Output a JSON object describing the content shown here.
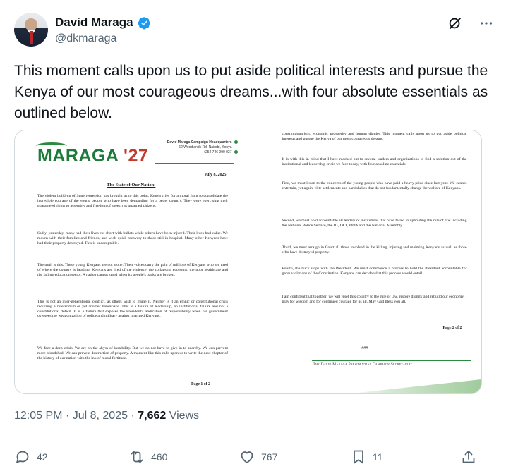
{
  "author": {
    "name": "David Maraga",
    "handle": "@dkmaraga"
  },
  "tweet": {
    "text": "This moment calls upon us to put aside political interests and pursue the Kenya of our most courageous dreams...with four absolute essentials as outlined below."
  },
  "document": {
    "logo_text": "MARAGA",
    "logo_year": "'27",
    "hq_title": "David Maraga Campaign Headquarters",
    "hq_address": "62 Woodlands Rd, Nairobi, Kenya",
    "hq_phone": "+254 746 990 027",
    "date": "July 8, 2025",
    "heading": "The State of Our Nation:",
    "page1_paragraphs": [
      "The violent build-up of State repression has brought us to this point. Kenya cries for a moral front to consolidate the incredible courage of the young people who have been demanding for a better country. They were exercising their guaranteed rights to assembly and freedom of speech as unarmed citizens.",
      "Sadly, yesterday, many had their lives cut short with bullets while others have been injured. Their lives had value. We mourn with their families and friends, and wish quick recovery to those still in hospital. Many other Kenyans have had their property destroyed. This is unacceptable.",
      "The truth is this. These young Kenyans are not alone. Their voices carry the pain of millions of Kenyans who are tired of where the country is heading. Kenyans are tired of the violence, the collapsing economy, the poor healthcare and the failing education sector. A nation cannot stand when its people's backs are broken.",
      "This is not an inter-generational conflict, as others wish to frame it. Neither is it an ethnic or constitutional crisis requiring a referendum or yet another handshake. This is a failure of leadership, an institutional failure and not a constitutional deficit. It is a failure that exposes the President's abdication of responsibility when his government oversees the weaponization of police and military against unarmed Kenyans.",
      "We face a deep crisis. We are on the abyss of instability. But we do not have to give in to anarchy. We can prevent more bloodshed. We can prevent destruction of property. A moment like this calls upon us to write the next chapter of the history of our nation with the ink of moral fortitude."
    ],
    "page1_number": "Page 1 of 2",
    "page2_paragraphs": [
      "constitutionalism, economic prosperity and human dignity. This moment calls upon us to put aside political interests and pursue the Kenya of our most courageous dreams.",
      "It is with this in mind that I have reached out to several leaders and organizations to find a solution out of the institutional and leadership crisis we face today, with four absolute essentials:",
      "First, we must listen to the concerns of the young people who have paid a heavy price since last year. We cannot entertain, yet again, elite settlements and handshakes that do not fundamentally change the welfare of Kenyans.",
      "Second, we must hold accountable all leaders of institutions that have failed in upholding the rule of law including the National Police Service, the IG, DCI, IPOA and the National Assembly.",
      "Third, we must arraign in Court all those involved in the killing, injuring and maiming Kenyans as well as those who have destroyed property.",
      "Fourth, the buck stops with the President. We must commence a process to hold the President accountable for gross violations of the Constitution. Kenyans can decide what this process would entail.",
      "I am confident that together, we will reset this country to the rule of law, restore dignity and rebuild our economy. I pray for wisdom and for continued courage for us all. May God bless you all."
    ],
    "page2_number": "Page 2 of 2",
    "end_mark": "###",
    "signature": "The David Maraga Presidential Campaign Secretariat"
  },
  "meta": {
    "time": "12:05 PM",
    "date": "Jul 8, 2025",
    "views_count": "7,662",
    "views_label": "Views"
  },
  "actions": {
    "replies": "42",
    "reposts": "460",
    "likes": "767",
    "bookmarks": "11"
  },
  "colors": {
    "brand_green": "#1d7a3a",
    "brand_red": "#c0392b",
    "verified_blue": "#1d9bf0",
    "secondary_text": "#536471"
  },
  "icons": [
    "verified-badge-icon",
    "grok-icon",
    "more-icon",
    "reply-icon",
    "repost-icon",
    "like-icon",
    "bookmark-icon",
    "share-icon"
  ]
}
